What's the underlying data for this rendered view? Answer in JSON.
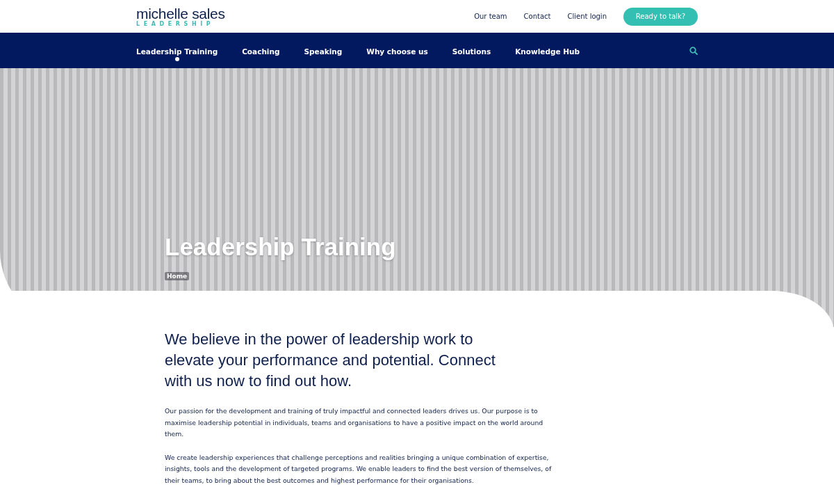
{
  "logo": {
    "name": "michelle sales",
    "tagline": "LEADERSHIP"
  },
  "top_links": [
    "Our team",
    "Contact",
    "Client login"
  ],
  "cta_button": "Ready to talk?",
  "nav": [
    {
      "label": "Leadership Training",
      "selected": true
    },
    {
      "label": "Coaching",
      "selected": false
    },
    {
      "label": "Speaking",
      "selected": false
    },
    {
      "label": "Why choose us",
      "selected": false
    },
    {
      "label": "Solutions",
      "selected": false
    },
    {
      "label": "Knowledge Hub",
      "selected": false
    }
  ],
  "hero": {
    "title": "Leadership Training",
    "breadcrumb": "Home"
  },
  "intro": {
    "heading": "We believe in the power of leadership work to elevate your performance and potential. Connect with us now to find out how.",
    "paragraphs": [
      "Our passion for the development and training of truly impactful and connected leaders drives us. Our purpose is to maximise leadership potential in individuals, teams and organisations to have a positive impact on the world around them.",
      "We create leadership experiences that challenge perceptions and realities bringing a unique combination of expertise, insights, tools and the development of targeted programs. We enable leaders to find the best version of themselves, of their teams, to bring about the best outcomes and highest performance for their organisations."
    ]
  }
}
